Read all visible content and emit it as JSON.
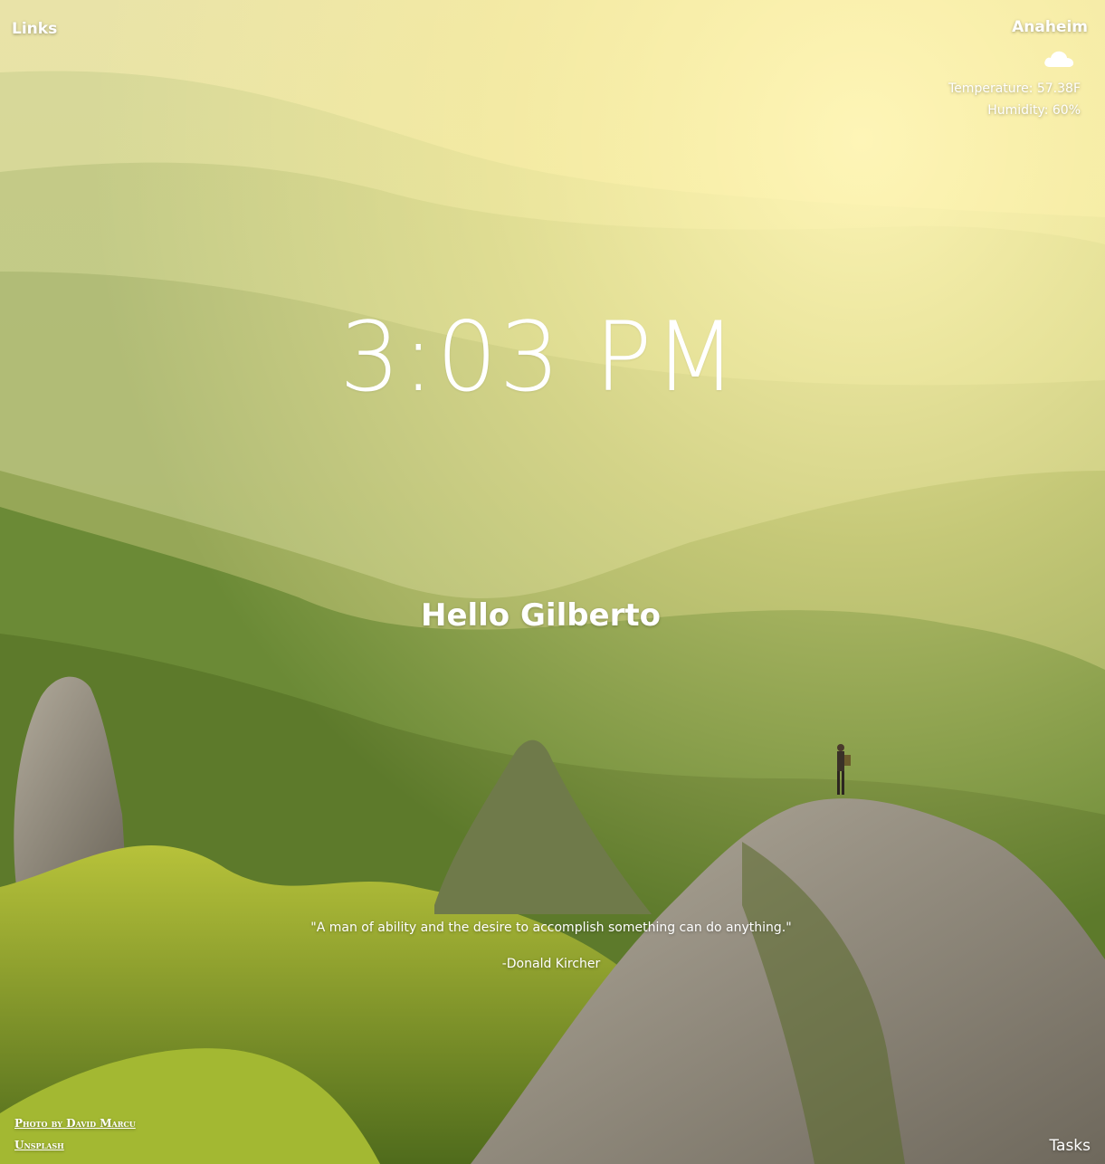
{
  "nav": {
    "links_label": "Links",
    "tasks_label": "Tasks"
  },
  "weather": {
    "city": "Anaheim",
    "icon": "cloud-icon",
    "temperature": "Temperature: 57.38F",
    "humidity": "Humidity: 60%"
  },
  "clock": {
    "time": "3:03 PM"
  },
  "greeting": "Hello Gilberto",
  "quote": {
    "text": "\"A man of ability and the desire to accomplish something can do anything.\"",
    "author": "-Donald Kircher"
  },
  "credit": {
    "photographer_link": "Photo by David Marcu",
    "source_link": "Unsplash"
  },
  "colors": {
    "text": "#ffffff",
    "sky_glow": "#fff2a8",
    "forest": "#6b8a36",
    "rock": "#8f887b"
  }
}
